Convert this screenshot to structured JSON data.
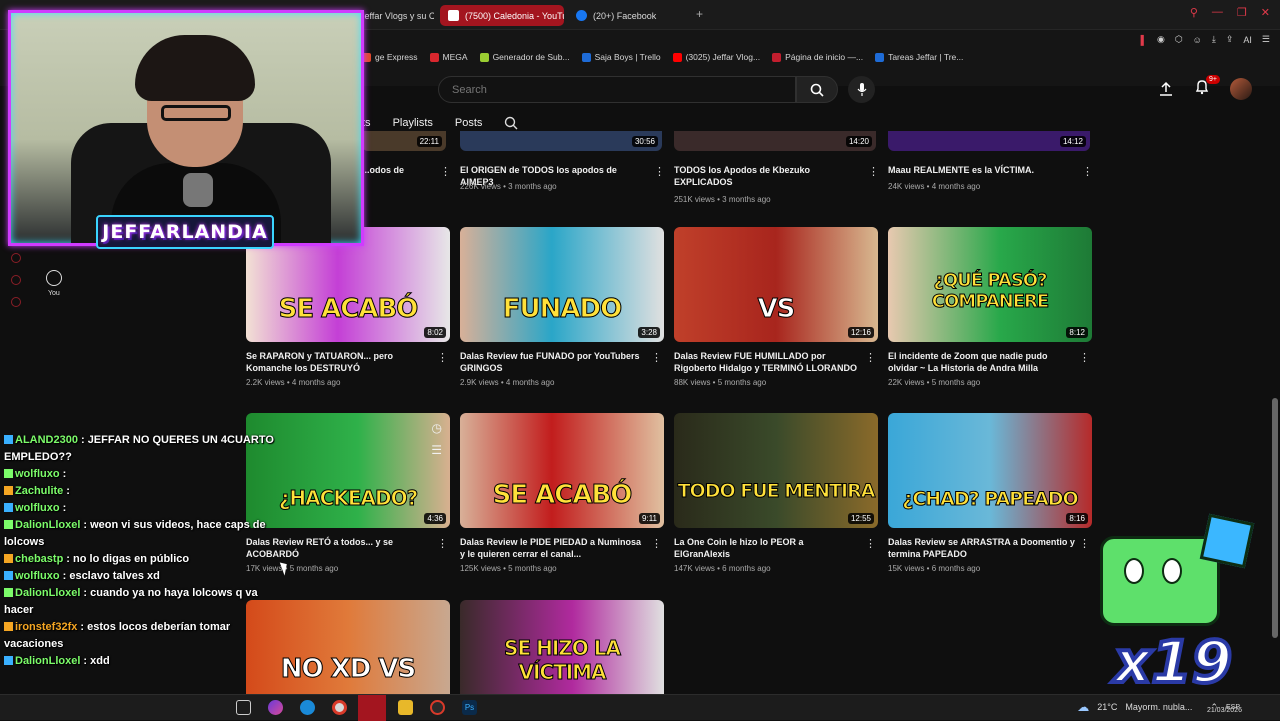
{
  "browser": {
    "tabs": [
      {
        "label": "Jeffar Vlogs y su C",
        "active": false,
        "color": "#888888"
      },
      {
        "label": "(7500) Caledonia - YouTu",
        "active": true,
        "color": "#ff0000"
      },
      {
        "label": "(20+) Facebook",
        "active": false,
        "color": "#1877f2"
      }
    ],
    "new_tab_icon": "+",
    "bookmarks": [
      {
        "label": "ge Express",
        "color": "#e04a2a"
      },
      {
        "label": "MEGA",
        "color": "#d9272e"
      },
      {
        "label": "Generador de Sub...",
        "color": "#9acd32"
      },
      {
        "label": "Saja Boys | Trello",
        "color": "#1e6bd6"
      },
      {
        "label": "(3025) Jeffar Vlog...",
        "color": "#ff0000"
      },
      {
        "label": "Página de inicio —...",
        "color": "#c21e2e"
      },
      {
        "label": "Tareas Jeffar | Tre...",
        "color": "#1e6bd6"
      }
    ],
    "toolbar_ai": "AI"
  },
  "youtube": {
    "search_placeholder": "Search",
    "notification_count": "9+",
    "channel_tabs": [
      "ts",
      "Playlists",
      "Posts"
    ],
    "sidebar_you": "You",
    "row_top": [
      {
        "title": "...odos de",
        "stats": "",
        "duration": "22:11"
      },
      {
        "title": "El ORIGEN de TODOS los apodos de AIMEP3",
        "stats": "226K views • 3 months ago",
        "duration": "30:56"
      },
      {
        "title": "TODOS los Apodos de Kbezuko EXPLICADOS",
        "stats": "251K views • 3 months ago",
        "duration": "14:20"
      },
      {
        "title": "Maau REALMENTE es la VÍCTIMA.",
        "stats": "24K views • 4 months ago",
        "duration": "14:12"
      }
    ],
    "row_mid": [
      {
        "title": "Se RAPARON y TATUARON... pero Komanche los DESTRUYÓ",
        "stats": "2.2K views • 4 months ago",
        "duration": "8:02",
        "overlay": "SE ACABÓ",
        "bg": "#c43fd6",
        "overlay_color": "#ffe13a"
      },
      {
        "title": "Dalas Review fue FUNADO por YouTubers GRINGOS",
        "stats": "2.9K views • 4 months ago",
        "duration": "3:28",
        "overlay": "FUNADO",
        "bg": "#2aa6c8",
        "overlay_color": "#ffe13a"
      },
      {
        "title": "Dalas Review FUE HUMILLADO por Rigoberto Hidalgo y TERMINÓ LLORANDO",
        "stats": "88K views • 5 months ago",
        "duration": "12:16",
        "overlay": "VS",
        "bg": "#a8251d",
        "overlay_color": "#ffffff"
      },
      {
        "title": "El incidente de Zoom que nadie pudo olvidar ~ La Historia de Andra Milla",
        "stats": "22K views • 5 months ago",
        "duration": "8:12",
        "overlay": "¿QUÉ PASÓ? COMPANERE",
        "bg": "#28a84a",
        "overlay_color": "#ffe13a"
      }
    ],
    "row_low": [
      {
        "title": "Dalas Review RETÓ a todos... y se ACOBARDÓ",
        "stats": "17K views • 5 months ago",
        "duration": "4:36",
        "overlay": "¿HACKEADO?",
        "bg": "#1e8a2e",
        "overlay_color": "#ffe13a"
      },
      {
        "title": "Dalas Review le PIDE PIEDAD a Numinosa y le quieren cerrar el canal...",
        "stats": "125K views • 5 months ago",
        "duration": "9:11",
        "overlay": "SE ACABÓ",
        "bg": "#c21d1d",
        "overlay_color": "#ffe13a"
      },
      {
        "title": "La One Coin le hizo lo PEOR a ElGranAlexis",
        "stats": "147K views • 6 months ago",
        "duration": "12:55",
        "overlay": "TODO FUE MENTIRA",
        "bg": "#3a4a2a",
        "overlay_color": "#ffe13a"
      },
      {
        "title": "Dalas Review se ARRASTRA a Doomentio y termina PAPEADO",
        "stats": "15K views • 6 months ago",
        "duration": "8:16",
        "overlay": "¿CHAD? PAPEADO",
        "bg": "#3aa7d8",
        "overlay_color": "#ffe13a"
      }
    ],
    "row_bottom": [
      {
        "overlay": "NO XD  VS",
        "bg": "#d44a1a",
        "overlay_color": "#ffffff"
      },
      {
        "overlay": "SE HIZO LA VÍCTIMA",
        "bg": "#b02a9e",
        "overlay_color": "#ffe13a"
      }
    ]
  },
  "stream_overlay": {
    "banner": "JEFFARLANDIA",
    "multiplier": "x19",
    "chat": [
      {
        "user": "ALAND2300",
        "color": "#7cfc6a",
        "text": ": JEFFAR NO QUERES UN 4CUARTO EMPLEDO??",
        "wrap": true
      },
      {
        "user": "wolfluxo",
        "color": "#7cfc6a",
        "text": ":",
        "wrap": false
      },
      {
        "user": "Zachulite",
        "color": "#7cfc6a",
        "text": ":",
        "wrap": false
      },
      {
        "user": "wolfluxo",
        "color": "#7cfc6a",
        "text": ":",
        "wrap": false
      },
      {
        "user": "DalionLloxel",
        "color": "#7cfc6a",
        "text": ": weon vi sus videos, hace caps de lolcows",
        "wrap": true
      },
      {
        "user": "chebastp",
        "color": "#7cfc6a",
        "text": ": no lo digas en público",
        "wrap": false
      },
      {
        "user": "wolfluxo",
        "color": "#7cfc6a",
        "text": ": esclavo talves xd",
        "wrap": false
      },
      {
        "user": "DalionLloxel",
        "color": "#7cfc6a",
        "text": ": cuando ya no haya lolcows q va hacer",
        "wrap": true
      },
      {
        "user": "ironstef32fx",
        "color": "#f5a623",
        "text": ": estos locos deberían tomar vacaciones",
        "wrap": true
      },
      {
        "user": "DalionLloxel",
        "color": "#7cfc6a",
        "text": ": xdd",
        "wrap": false
      }
    ]
  },
  "taskbar": {
    "weather_temp": "21°C",
    "weather_text": "Mayorm. nubla...",
    "lang": "ESP",
    "date": "21/03/2026"
  }
}
